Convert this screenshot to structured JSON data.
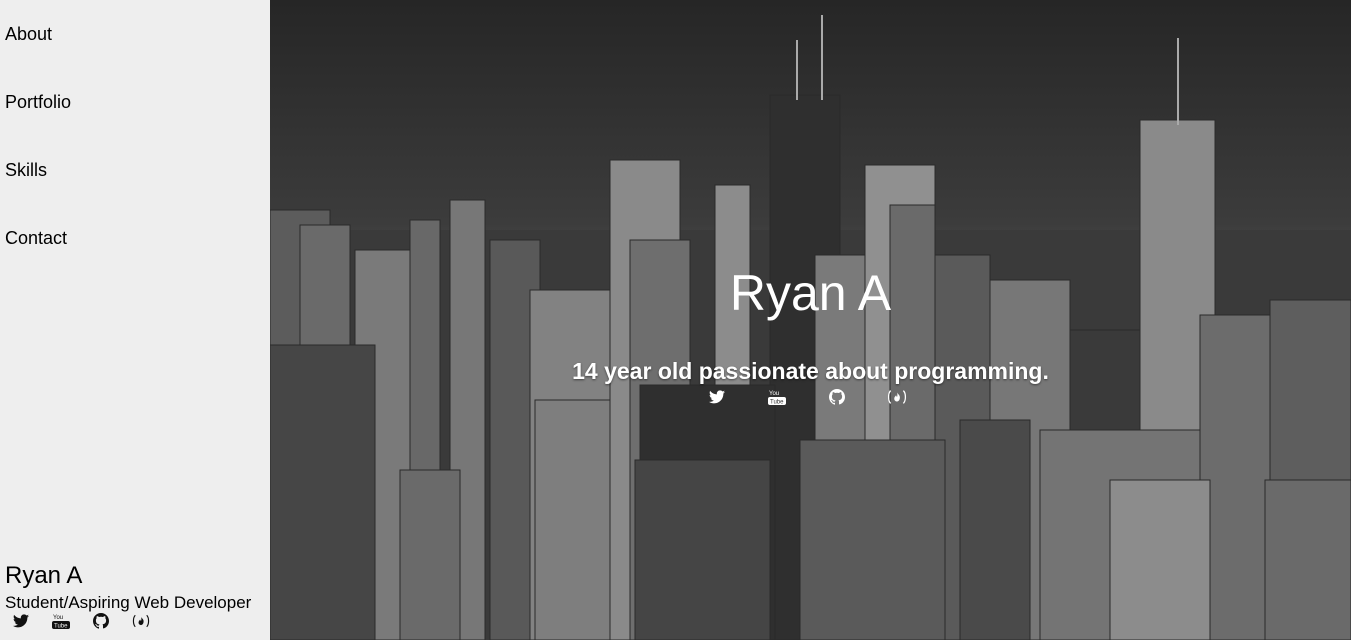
{
  "nav": {
    "items": [
      {
        "label": "About"
      },
      {
        "label": "Portfolio"
      },
      {
        "label": "Skills"
      },
      {
        "label": "Contact"
      }
    ]
  },
  "sidebar": {
    "name": "Ryan A",
    "tagline": "Student/Aspiring Web Developer",
    "social": [
      "twitter-icon",
      "youtube-icon",
      "github-icon",
      "freecodecamp-icon"
    ]
  },
  "hero": {
    "title": "Ryan A",
    "subtitle": "14 year old passionate about programming.",
    "social": [
      "twitter-icon",
      "youtube-icon",
      "github-icon",
      "freecodecamp-icon"
    ]
  },
  "colors": {
    "sidebar_bg": "#eeeeee",
    "hero_text": "#ffffff"
  }
}
